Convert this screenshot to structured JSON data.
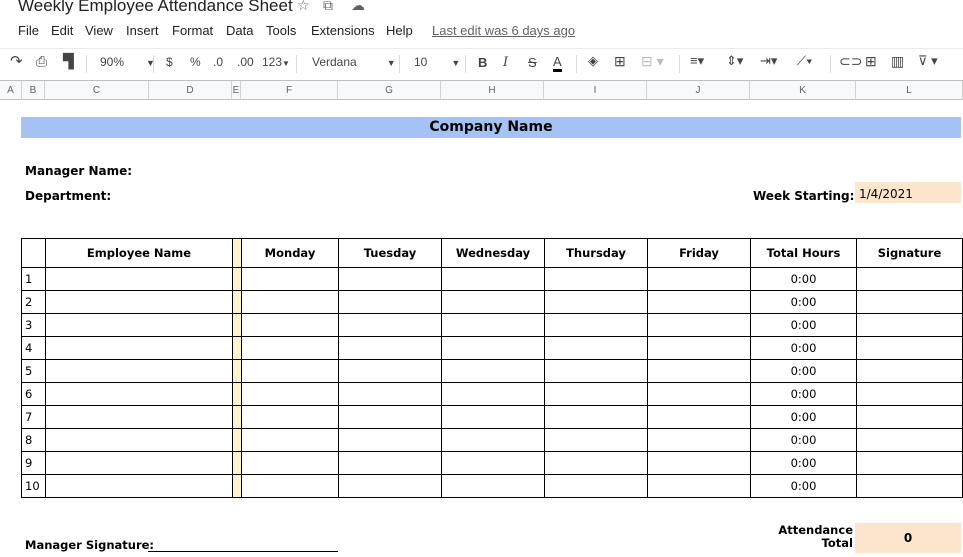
{
  "window": {
    "title": "Weekly Employee Attendance Sheet",
    "icons": [
      "star-icon",
      "move-to-folder-icon",
      "cloud-status-icon"
    ]
  },
  "menubar": {
    "items": [
      "File",
      "Edit",
      "View",
      "Insert",
      "Format",
      "Data",
      "Tools",
      "Extensions",
      "Help"
    ],
    "last_edit": "Last edit was 6 days ago"
  },
  "toolbar": {
    "zoom": "90%",
    "currency": "$",
    "percent": "%",
    "decrease_decimal": ".0",
    "increase_decimal": ".00",
    "more_formats": "123",
    "font": "Verdana",
    "font_size": "10",
    "bold": "B",
    "italic": "I",
    "strikethrough": "S",
    "text_color": "A"
  },
  "columns": [
    "A",
    "B",
    "C",
    "D",
    "E",
    "F",
    "G",
    "H",
    "I",
    "J",
    "K",
    "L"
  ],
  "sheet": {
    "company_name": "Company Name",
    "manager_name_label": "Manager Name:",
    "department_label": "Department:",
    "week_starting_label": "Week Starting:",
    "week_starting_value": "1/4/2021",
    "table": {
      "headers": [
        "",
        "Employee Name",
        "",
        "Monday",
        "Tuesday",
        "Wednesday",
        "Thursday",
        "Friday",
        "Total Hours",
        "Signature"
      ],
      "rows": [
        {
          "num": "1",
          "total": "0:00"
        },
        {
          "num": "2",
          "total": "0:00"
        },
        {
          "num": "3",
          "total": "0:00"
        },
        {
          "num": "4",
          "total": "0:00"
        },
        {
          "num": "5",
          "total": "0:00"
        },
        {
          "num": "6",
          "total": "0:00"
        },
        {
          "num": "7",
          "total": "0:00"
        },
        {
          "num": "8",
          "total": "0:00"
        },
        {
          "num": "9",
          "total": "0:00"
        },
        {
          "num": "10",
          "total": "0:00"
        }
      ]
    },
    "manager_signature_label": "Manager Signature:",
    "attendance_total_label_1": "Attendance",
    "attendance_total_label_2": "Total",
    "attendance_total_value": "0"
  },
  "colors": {
    "header_band": "#a4c2f4",
    "highlight_cell": "#fce5cd",
    "spacer_column": "#fff2cc"
  }
}
